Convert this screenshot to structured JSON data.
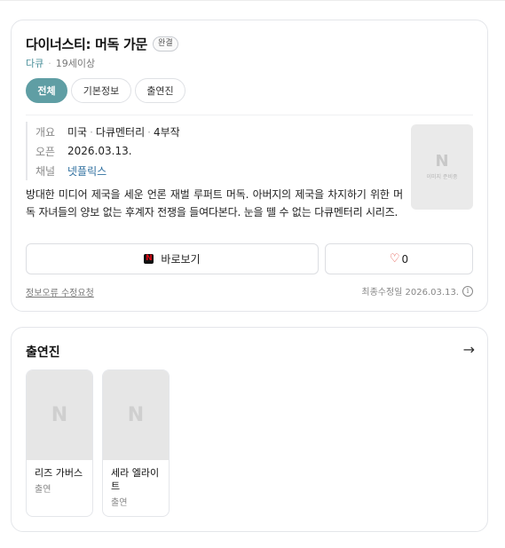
{
  "header": {
    "title": "다이너스티: 머독 가문",
    "badge": "완결",
    "genre": "다큐",
    "age_rating": "19세이상"
  },
  "tabs": [
    {
      "label": "전체",
      "active": true
    },
    {
      "label": "기본정보",
      "active": false
    },
    {
      "label": "출연진",
      "active": false
    }
  ],
  "info": {
    "overview_label": "개요",
    "overview_country": "미국",
    "overview_genre": "다큐멘터리",
    "overview_episodes": "4부작",
    "open_label": "오픈",
    "open_date": "2026.03.13.",
    "channel_label": "채널",
    "channel_value": "넷플릭스",
    "description": "방대한 미디어 제국을 세운 언론 재벌 루퍼트 머독. 아버지의 제국을 차지하기 위한 머독 자녀들의 양보 없는 후계자 전쟁을 들여다본다. 눈을 뗄 수 없는 다큐멘터리 시리즈.",
    "poster_logo": "N",
    "poster_placeholder": "이미지 준비중"
  },
  "actions": {
    "watch_label": "바로보기",
    "netflix_mark": "N",
    "like_count": "0"
  },
  "footer": {
    "report_label": "정보오류 수정요청",
    "updated_text": "최종수정일 2026.03.13.",
    "info_icon": "i"
  },
  "cast": {
    "title": "출연진",
    "arrow": "→",
    "members": [
      {
        "name": "리즈 가버스",
        "role": "출연",
        "photo_logo": "N"
      },
      {
        "name": "세라 엘라이트",
        "role": "출연",
        "photo_logo": "N"
      }
    ]
  },
  "colors": {
    "accent": "#5f9ea4",
    "genre_text": "#4a8f9a",
    "heart": "#e0463b",
    "netflix_red": "#e50914"
  },
  "icons": {
    "heart": "heart-icon",
    "netflix": "netflix-icon",
    "info": "info-icon",
    "arrow": "arrow-right-icon"
  }
}
